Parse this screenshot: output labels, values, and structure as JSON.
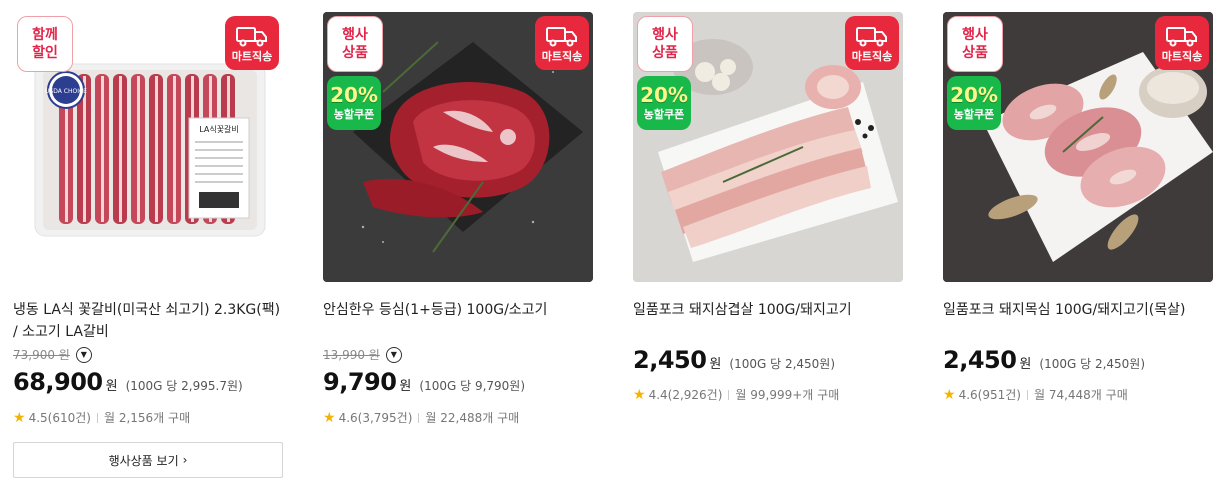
{
  "products": [
    {
      "top_badge": "함께\n할인",
      "mart_badge": "마트직송",
      "has_coupon": false,
      "title": "냉동 LA식 꽃갈비(미국산 쇠고기) 2.3KG(팩) / 소고기 LA갈비",
      "original_price": "73,900 원",
      "price": "68,900",
      "won": "원",
      "unit_price": "(100G 당 2,995.7원)",
      "rating": "4.5(610건)",
      "purchases": "월 2,156개 구매",
      "more_label": "행사상품 보기",
      "image_label": "LA식꽃갈비",
      "usda_label": "USDA CHOICE"
    },
    {
      "top_badge": "행사\n상품",
      "mart_badge": "마트직송",
      "has_coupon": true,
      "coupon_pct": "20%",
      "coupon_label": "농할쿠폰",
      "title": "안심한우 등심(1+등급) 100G/소고기",
      "original_price": "13,990 원",
      "price": "9,790",
      "won": "원",
      "unit_price": "(100G 당 9,790원)",
      "rating": "4.6(3,795건)",
      "purchases": "월 22,488개 구매"
    },
    {
      "top_badge": "행사\n상품",
      "mart_badge": "마트직송",
      "has_coupon": true,
      "coupon_pct": "20%",
      "coupon_label": "농할쿠폰",
      "title": "일품포크 돼지삼겹살 100G/돼지고기",
      "price": "2,450",
      "won": "원",
      "unit_price": "(100G 당 2,450원)",
      "rating": "4.4(2,926건)",
      "purchases": "월 99,999+개 구매"
    },
    {
      "top_badge": "행사\n상품",
      "mart_badge": "마트직송",
      "has_coupon": true,
      "coupon_pct": "20%",
      "coupon_label": "농할쿠폰",
      "title": "일품포크 돼지목심 100G/돼지고기(목살)",
      "price": "2,450",
      "won": "원",
      "unit_price": "(100G 당 2,450원)",
      "rating": "4.6(951건)",
      "purchases": "월 74,448개 구매"
    }
  ],
  "colors": {
    "accent_red": "#e8283c",
    "coupon_green": "#18b84a",
    "star": "#f5b301"
  }
}
